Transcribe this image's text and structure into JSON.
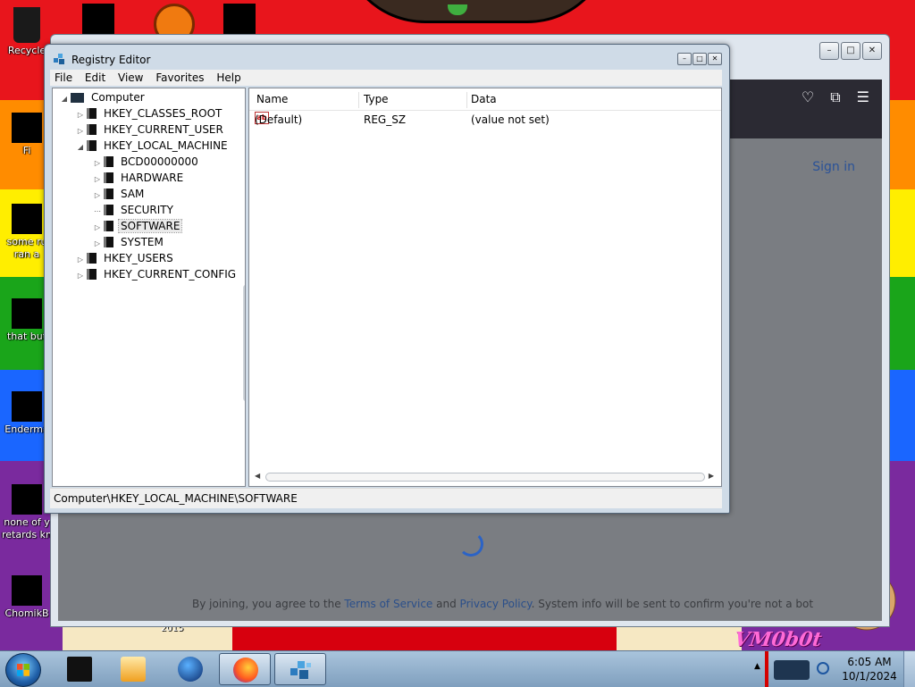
{
  "desktop": {
    "icons": [
      {
        "label": "Recycle"
      },
      {
        "label": "Fi"
      },
      {
        "label": "some ru"
      },
      {
        "label": "ran a"
      },
      {
        "label": "that but"
      },
      {
        "label": "Enderma"
      },
      {
        "label": "none of y"
      },
      {
        "label": "retards kn"
      },
      {
        "label": "ChomikB"
      }
    ],
    "watermark": "VM0b0t",
    "year_label": "2015",
    "stripe_colors": [
      "#e8151c",
      "#ff8c00",
      "#ffee00",
      "#1aa51a",
      "#1a66ff",
      "#7a2a9e"
    ]
  },
  "firefox": {
    "sign_in": "Sign in",
    "footer": {
      "prefix": "By joining, you agree to the",
      "terms": "Terms of Service",
      "and": "and",
      "privacy": "Privacy Policy",
      "suffix": ". System info will be sent to confirm you're not a bot"
    }
  },
  "registry_editor": {
    "title": "Registry Editor",
    "menu": [
      "File",
      "Edit",
      "View",
      "Favorites",
      "Help"
    ],
    "tree": {
      "root": "Computer",
      "hives": [
        "HKEY_CLASSES_ROOT",
        "HKEY_CURRENT_USER",
        "HKEY_LOCAL_MACHINE",
        "HKEY_USERS",
        "HKEY_CURRENT_CONFIG"
      ],
      "local_machine_children": [
        "BCD00000000",
        "HARDWARE",
        "SAM",
        "SECURITY",
        "SOFTWARE",
        "SYSTEM"
      ],
      "selected": "SOFTWARE"
    },
    "columns": {
      "name": "Name",
      "type": "Type",
      "data": "Data"
    },
    "values": [
      {
        "name": "(Default)",
        "type": "REG_SZ",
        "data": "(value not set)"
      }
    ],
    "status_path": "Computer\\HKEY_LOCAL_MACHINE\\SOFTWARE"
  },
  "taskbar": {
    "clock_time": "6:05 AM",
    "clock_date": "10/1/2024",
    "buttons": [
      "media-player",
      "globe-app",
      "firefox",
      "registry-editor"
    ],
    "active_button": "registry-editor"
  }
}
